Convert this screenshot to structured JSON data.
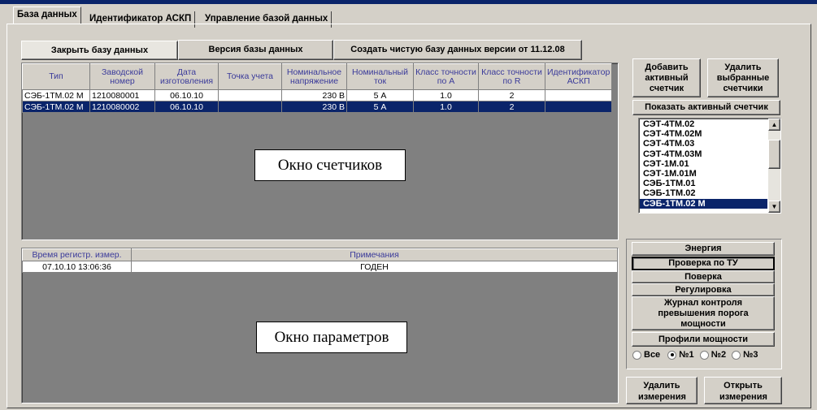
{
  "tabs": [
    {
      "label": "База данных"
    },
    {
      "label": "Идентификатор АСКП"
    },
    {
      "label": "Управление базой данных"
    }
  ],
  "toolbar": {
    "close_db": "Закрыть базу данных",
    "db_version": "Версия базы данных",
    "create_clean_db": "Создать чистую базу данных версии от 11.12.08"
  },
  "meters_table": {
    "headers": [
      "Тип",
      "Заводской номер",
      "Дата изготовления",
      "Точка учета",
      "Номинальное напряжение",
      "Номинальный ток",
      "Класс точности по А",
      "Класс точности по R",
      "Идентификатор АСКП"
    ],
    "rows": [
      [
        "СЭБ-1ТМ.02 М",
        "1210080001",
        "06.10.10",
        "",
        "230 В",
        "5 А",
        "1.0",
        "2",
        ""
      ],
      [
        "СЭБ-1ТМ.02 М",
        "1210080002",
        "06.10.10",
        "",
        "230 В",
        "5 А",
        "1.0",
        "2",
        ""
      ]
    ]
  },
  "meters_window_label": "Окно счетчиков",
  "params_table": {
    "headers": [
      "Время регистр. измер.",
      "Примечания"
    ],
    "rows": [
      [
        "07.10.10 13:06:36",
        "ГОДЕН"
      ]
    ]
  },
  "params_window_label": "Окно параметров",
  "right_panel": {
    "add_active": "Добавить активный счетчик",
    "delete_selected": "Удалить выбранные счетчики",
    "show_active": "Показать активный счетчик",
    "meter_types": [
      "СЭТ-4ТМ.02",
      "СЭТ-4ТМ.02М",
      "СЭТ-4ТМ.03",
      "СЭТ-4ТМ.03М",
      "СЭТ-1М.01",
      "СЭТ-1М.01М",
      "СЭБ-1ТМ.01",
      "СЭБ-1ТМ.02",
      "СЭБ-1ТМ.02 М"
    ],
    "selected_meter_type": "СЭБ-1ТМ.02 М",
    "energy": "Энергия",
    "check_tu": "Проверка по ТУ",
    "check": "Поверка",
    "adjustment": "Регулировка",
    "power_log": "Журнал контроля превышения порога мощности",
    "power_profiles": "Профили мощности",
    "radio": [
      {
        "label": "Все",
        "checked": false
      },
      {
        "label": "№1",
        "checked": true
      },
      {
        "label": "№2",
        "checked": false
      },
      {
        "label": "№3",
        "checked": false
      }
    ],
    "delete_measurements": "Удалить измерения",
    "open_measurements": "Открыть измерения"
  }
}
